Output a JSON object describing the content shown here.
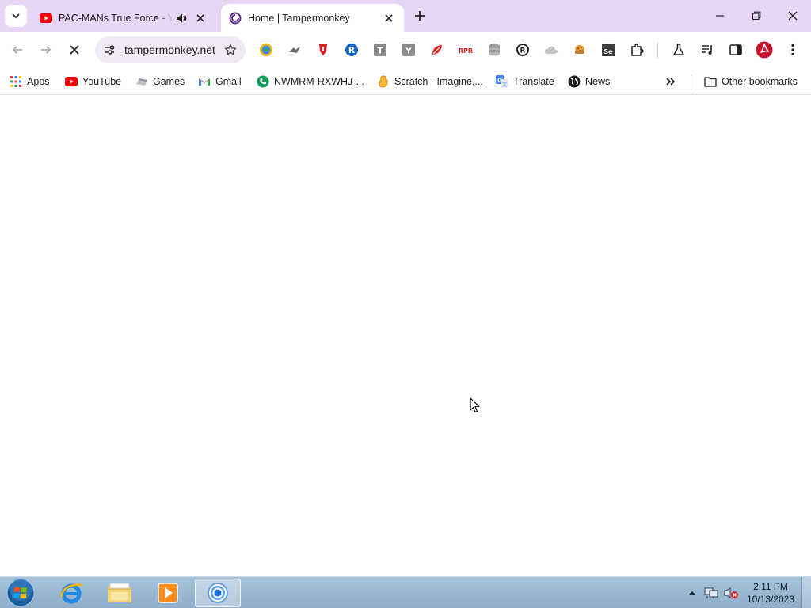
{
  "browser": {
    "tabs": [
      {
        "title": "PAC-MANs True Force - YouTube",
        "icon": "youtube-icon",
        "audio": true,
        "active": false
      },
      {
        "title": "Home | Tampermonkey",
        "icon": "tampermonkey-icon",
        "active": true
      }
    ],
    "omnibox": {
      "url": "tampermonkey.net"
    },
    "extensions": [
      "google-lens-icon",
      "dragon-icon",
      "red-shield-icon",
      "r-circle-icon",
      "t-square-icon",
      "y-square-icon",
      "red-leaf-icon",
      "rpr-icon",
      "stack-icon",
      "r-dark-icon",
      "cloud-icon",
      "cookie-icon",
      "se-icon",
      "puzzle-icon"
    ],
    "colors": {
      "tab_strip": "#e9d6f7",
      "accent": "#5f2e8a"
    }
  },
  "bookmarks": {
    "items": [
      {
        "label": "Apps",
        "icon": "apps-grid-icon"
      },
      {
        "label": "YouTube",
        "icon": "youtube-icon"
      },
      {
        "label": "Games",
        "icon": "games-icon"
      },
      {
        "label": "Gmail",
        "icon": "gmail-icon"
      },
      {
        "label": "NWMRM-RXWHJ-...",
        "icon": "phone-icon"
      },
      {
        "label": "Scratch - Imagine,...",
        "icon": "scratch-icon"
      },
      {
        "label": "Translate",
        "icon": "translate-icon"
      },
      {
        "label": "News",
        "icon": "globe-icon"
      }
    ],
    "other": "Other bookmarks"
  },
  "taskbar": {
    "clock_time": "2:11 PM",
    "clock_date": "10/13/2023",
    "pinned": [
      "internet-explorer-icon",
      "file-explorer-icon",
      "media-player-icon",
      "chrome-icon"
    ]
  }
}
